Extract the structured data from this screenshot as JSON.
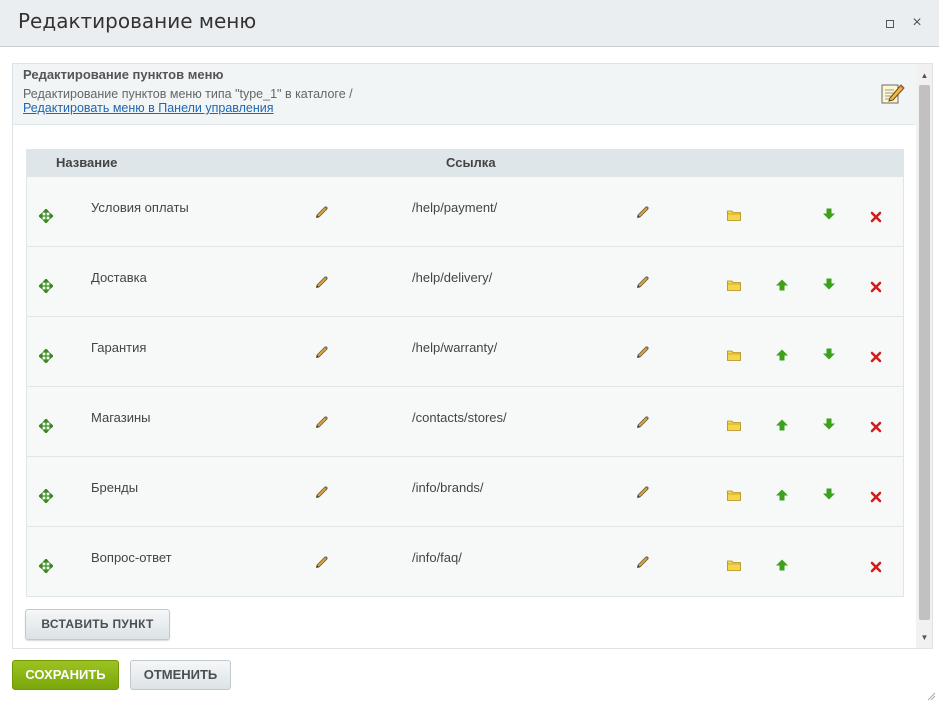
{
  "window": {
    "title": "Редактирование меню",
    "maximize_label": "maximize",
    "close_label": "×"
  },
  "info": {
    "heading": "Редактирование пунктов меню",
    "subtitle": "Редактирование пунктов меню типа \"type_1\" в каталоге /",
    "link": "Редактировать меню в Панели управления"
  },
  "table": {
    "headers": {
      "name": "Название",
      "link": "Ссылка"
    },
    "rows": [
      {
        "name": "Условия оплаты",
        "link": "/help/payment/",
        "can_up": false,
        "can_down": true
      },
      {
        "name": "Доставка",
        "link": "/help/delivery/",
        "can_up": true,
        "can_down": true
      },
      {
        "name": "Гарантия",
        "link": "/help/warranty/",
        "can_up": true,
        "can_down": true
      },
      {
        "name": "Магазины",
        "link": "/contacts/stores/",
        "can_up": true,
        "can_down": true
      },
      {
        "name": "Бренды",
        "link": "/info/brands/",
        "can_up": true,
        "can_down": true
      },
      {
        "name": "Вопрос-ответ",
        "link": "/info/faq/",
        "can_up": true,
        "can_down": false
      }
    ]
  },
  "buttons": {
    "insert": "ВСТАВИТЬ ПУНКТ",
    "save": "СОХРАНИТЬ",
    "cancel": "ОТМЕНИТЬ"
  },
  "colors": {
    "accent_green": "#8ab414",
    "link_blue": "#2067b0",
    "delete_red": "#d41c1c",
    "arrow_green": "#3ea11d",
    "folder_yellow": "#f5d64a"
  },
  "icons": [
    "move-icon",
    "pencil-icon",
    "folder-icon",
    "arrow-up-icon",
    "arrow-down-icon",
    "delete-icon",
    "edit-menu-icon"
  ]
}
